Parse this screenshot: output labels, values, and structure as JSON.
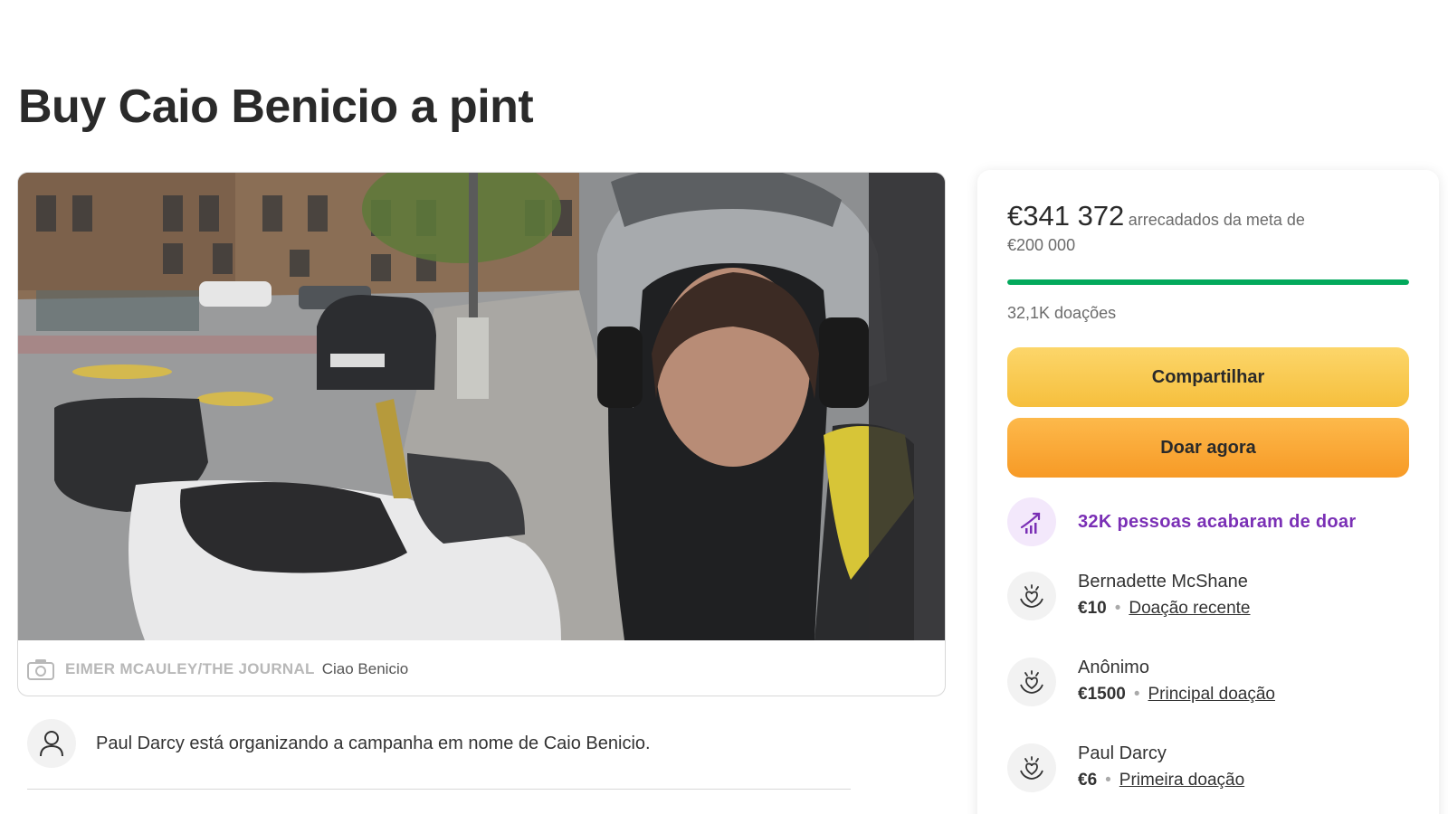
{
  "page": {
    "title": "Buy Caio Benicio a pint"
  },
  "media": {
    "photo_credit": "EIMER MCAULEY/THE JOURNAL",
    "caption": "Ciao Benicio"
  },
  "organizer": {
    "text": "Paul Darcy está organizando a campanha em nome de Caio Benicio."
  },
  "donation_panel": {
    "raised": "€341 372",
    "goal_label": "arrecadados da meta de",
    "goal": "€200 000",
    "progress_fraction": 1.0,
    "donations_count": "32,1K doações",
    "share_label": "Compartilhar",
    "donate_label": "Doar agora",
    "trend_text": "32K pessoas acabaram de doar",
    "donors": [
      {
        "name": "Bernadette McShane",
        "amount": "€10",
        "tag": "Doação recente"
      },
      {
        "name": "Anônimo",
        "amount": "€1500",
        "tag": "Principal doação"
      },
      {
        "name": "Paul Darcy",
        "amount": "€6",
        "tag": "Primeira doação"
      }
    ]
  },
  "colors": {
    "progress": "#02a95c",
    "share_button": "#f6bf3d",
    "donate_button": "#f79a26",
    "trend_accent": "#7a2fb5"
  },
  "icons": [
    "camera-icon",
    "user-icon",
    "trend-up-icon",
    "donation-hands-icon"
  ]
}
